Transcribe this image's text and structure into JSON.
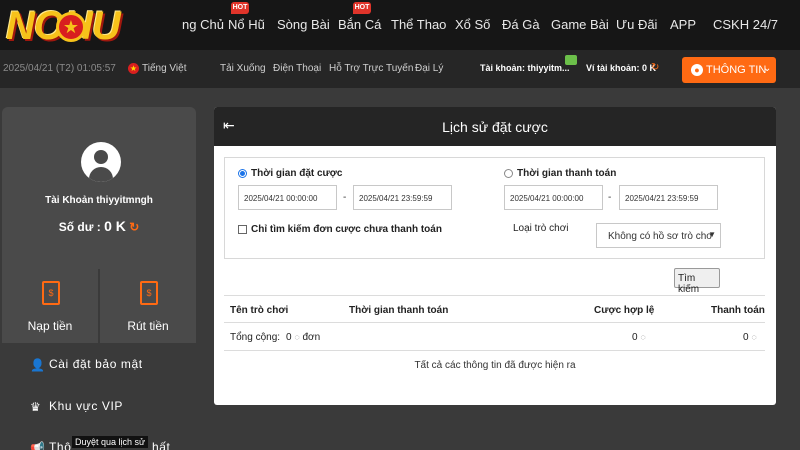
{
  "header": {
    "logo_text": "NOHU",
    "nav": [
      {
        "label": "ng Chủ",
        "hot": false
      },
      {
        "label": "Nổ Hũ",
        "hot": true
      },
      {
        "label": "Sòng Bài",
        "hot": false
      },
      {
        "label": "Bắn Cá",
        "hot": true
      },
      {
        "label": "Thể Thao",
        "hot": false
      },
      {
        "label": "Xổ Số",
        "hot": false
      },
      {
        "label": "Đá Gà",
        "hot": false
      },
      {
        "label": "Game Bài",
        "hot": false
      },
      {
        "label": "Ưu Đãi",
        "hot": false
      },
      {
        "label": "APP",
        "hot": false
      },
      {
        "label": "CSKH 24/7",
        "hot": false
      }
    ],
    "hot_label": "HOT"
  },
  "subbar": {
    "datetime": "2025/04/21 (T2) 01:05:57",
    "language": "Tiếng Việt",
    "links": [
      "Tải Xuống",
      "Điện Thoại",
      "Hỗ Trợ Trực Tuyến",
      "Đại Lý"
    ],
    "account_label": "Tài khoản: thiyyitm...",
    "wallet_label": "Ví tài khoản: 0 K",
    "info_button": "THÔNG TIN"
  },
  "sidebar": {
    "account_name": "Tài Khoản thiyyitmngh",
    "balance_label": "Số dư :",
    "balance_value": "0 K",
    "deposit": "Nạp tiền",
    "withdraw": "Rút tiền",
    "menu": [
      {
        "label": "Cài đặt bảo mật",
        "icon": "user-shield-icon"
      },
      {
        "label": "Khu vực VIP",
        "icon": "vip-crown-icon"
      },
      {
        "label": "Thô",
        "icon": "megaphone-icon"
      }
    ],
    "menu_tail": "hất",
    "tooltip": "Duyệt qua lịch sử"
  },
  "panel": {
    "title": "Lịch sử đặt cược",
    "radio_bet_time": "Thời gian đặt cược",
    "radio_pay_time": "Thời gian thanh toán",
    "bet_from": "2025/04/21 00:00:00",
    "bet_to": "2025/04/21 23:59:59",
    "pay_from": "2025/04/21 00:00:00",
    "pay_to": "2025/04/21 23:59:59",
    "dash": "-",
    "checkbox_label": "Chỉ tìm kiếm đơn cược chưa thanh toán",
    "game_type_label": "Loại trò chơi",
    "game_type_value": "Không có hồ sơ trò cho",
    "search_button": "Tìm kiếm",
    "columns": [
      "Tên trò chơi",
      "Thời gian thanh toán",
      "Cược hợp lệ",
      "Thanh toán"
    ],
    "total_label": "Tổng cộng:",
    "total_count": "0",
    "total_unit": "đơn",
    "total_valid": "0",
    "total_payout": "0",
    "footer": "Tất cả các thông tin đã được hiện ra"
  },
  "colors": {
    "accent": "#ff6a13",
    "header_bg": "#161616",
    "sidebar_bg": "#4a4a4a"
  }
}
